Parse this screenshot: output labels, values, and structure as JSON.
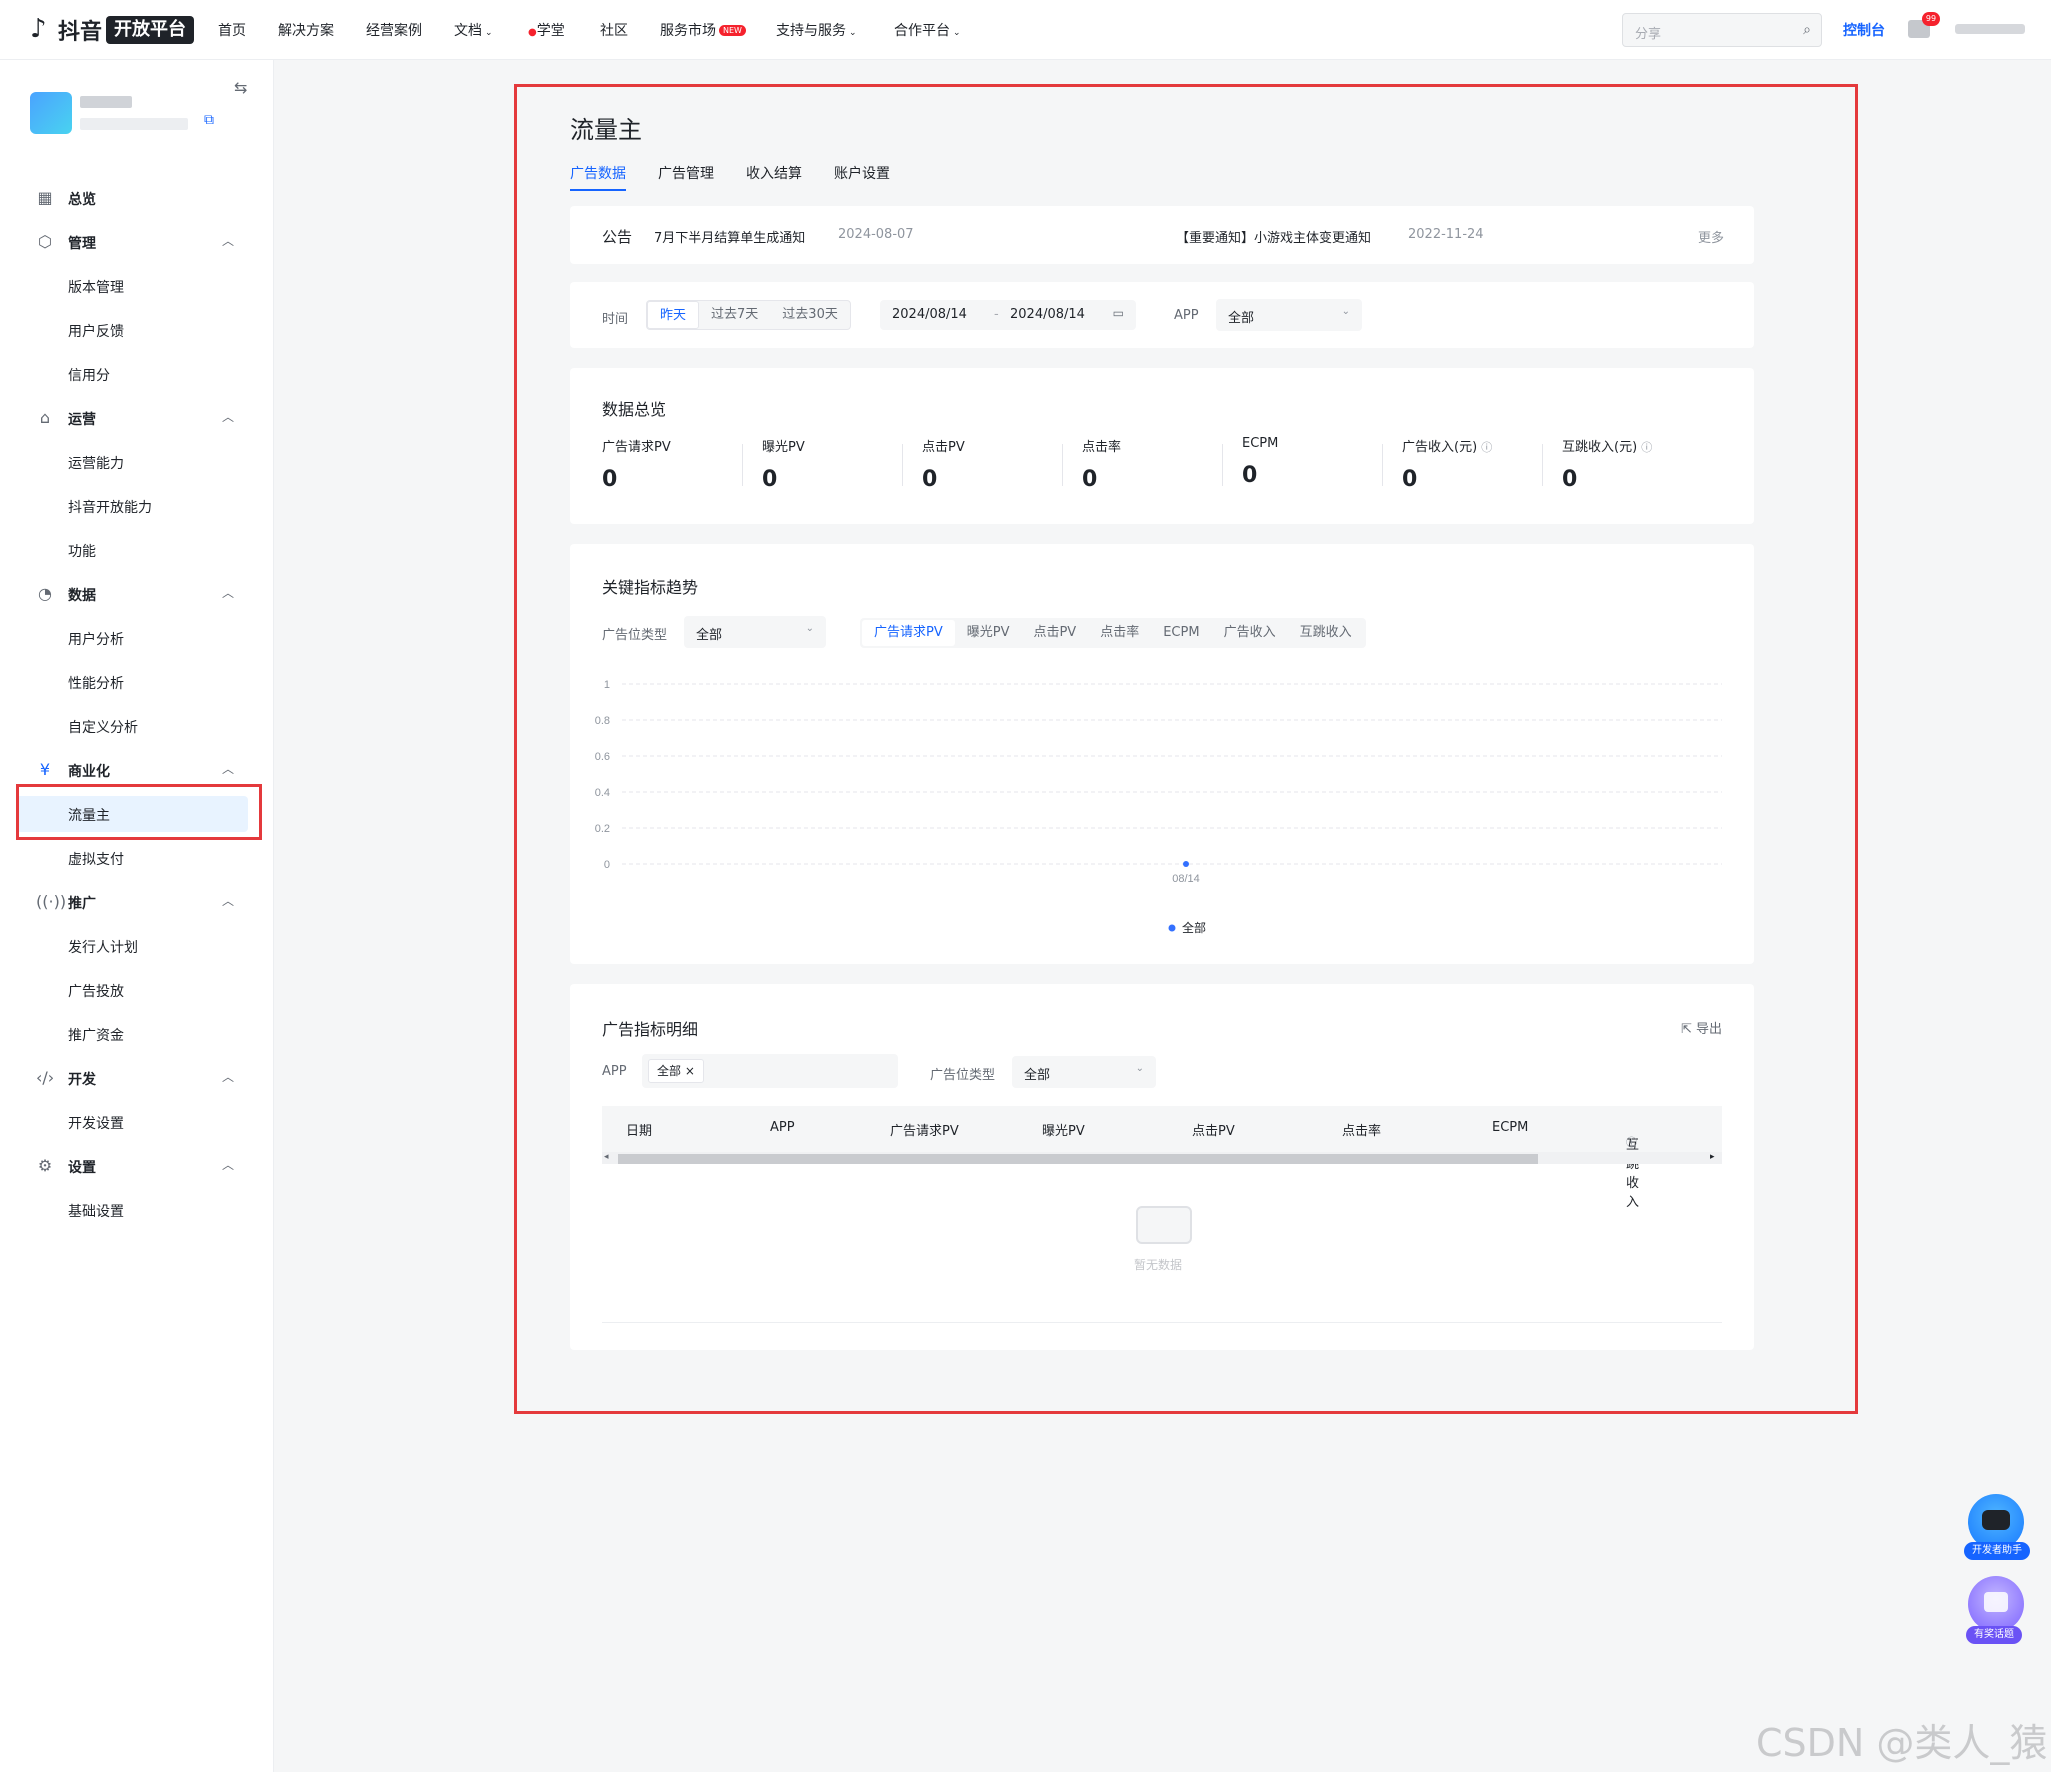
{
  "topbar": {
    "logo_main": "抖音",
    "logo_badge": "开放平台",
    "nav": [
      "首页",
      "解决方案",
      "经营案例",
      "文档",
      "学堂",
      "社区",
      "服务市场",
      "支持与服务",
      "合作平台"
    ],
    "nav_new_badge": "NEW",
    "search_placeholder": "分享",
    "console_label": "控制台",
    "msg_badge": "99"
  },
  "sidebar": {
    "groups": [
      {
        "label": "总览",
        "icon": "grid-icon"
      },
      {
        "label": "管理",
        "icon": "cube-icon",
        "items": [
          "版本管理",
          "用户反馈",
          "信用分"
        ]
      },
      {
        "label": "运营",
        "icon": "operation-icon",
        "items": [
          "运营能力",
          "抖音开放能力",
          "功能"
        ]
      },
      {
        "label": "数据",
        "icon": "pie-icon",
        "items": [
          "用户分析",
          "性能分析",
          "自定义分析"
        ]
      },
      {
        "label": "商业化",
        "icon": "yuan-icon",
        "items": [
          "流量主",
          "虚拟支付"
        ]
      },
      {
        "label": "推广",
        "icon": "broadcast-icon",
        "items": [
          "发行人计划",
          "广告投放",
          "推广资金"
        ]
      },
      {
        "label": "开发",
        "icon": "code-icon",
        "items": [
          "开发设置"
        ]
      },
      {
        "label": "设置",
        "icon": "gear-icon",
        "items": [
          "基础设置"
        ]
      }
    ],
    "active_item": "流量主"
  },
  "main": {
    "title": "流量主",
    "tabs": [
      "广告数据",
      "广告管理",
      "收入结算",
      "账户设置"
    ],
    "active_tab": "广告数据",
    "notice": {
      "label": "公告",
      "items": [
        {
          "text": "7月下半月结算单生成通知",
          "date": "2024-08-07"
        },
        {
          "text": "【重要通知】小游戏主体变更通知",
          "date": "2022-11-24"
        }
      ],
      "more": "更多"
    },
    "filter": {
      "time_label": "时间",
      "ranges": [
        "昨天",
        "过去7天",
        "过去30天"
      ],
      "active_range": "昨天",
      "date_start": "2024/08/14",
      "date_sep": "-",
      "date_end": "2024/08/14",
      "app_label": "APP",
      "app_value": "全部"
    },
    "overview": {
      "title": "数据总览",
      "metrics": [
        {
          "label": "广告请求PV",
          "value": "0"
        },
        {
          "label": "曝光PV",
          "value": "0"
        },
        {
          "label": "点击PV",
          "value": "0"
        },
        {
          "label": "点击率",
          "value": "0"
        },
        {
          "label": "ECPM",
          "value": "0"
        },
        {
          "label": "广告收入(元)",
          "value": "0"
        },
        {
          "label": "互跳收入(元)",
          "value": "0"
        }
      ]
    },
    "trend": {
      "title": "关键指标趋势",
      "slot_label": "广告位类型",
      "slot_value": "全部",
      "metric_tabs": [
        "广告请求PV",
        "曝光PV",
        "点击PV",
        "点击率",
        "ECPM",
        "广告收入",
        "互跳收入"
      ],
      "active_metric": "广告请求PV"
    },
    "detail": {
      "title": "广告指标明细",
      "export_label": "导出",
      "app_label": "APP",
      "app_tag": "全部",
      "slot_label": "广告位类型",
      "slot_value": "全部",
      "columns": [
        "日期",
        "APP",
        "广告请求PV",
        "曝光PV",
        "点击PV",
        "点击率",
        "ECPM",
        "互跳收入"
      ],
      "empty_text": "暂无数据"
    }
  },
  "fabs": {
    "assistant": "开发者助手",
    "topic": "有奖话题"
  },
  "watermark": "CSDN @类人_猿",
  "chart_data": {
    "type": "line",
    "x": [
      "08/14"
    ],
    "series": [
      {
        "name": "全部",
        "values": [
          0
        ]
      }
    ],
    "ylim": [
      0,
      1
    ],
    "yticks": [
      "0",
      "0.2",
      "0.4",
      "0.6",
      "0.8",
      "1"
    ],
    "xlabel": "",
    "ylabel": "",
    "grid": true,
    "legend": "bottom-center",
    "color": "#3370ff"
  }
}
